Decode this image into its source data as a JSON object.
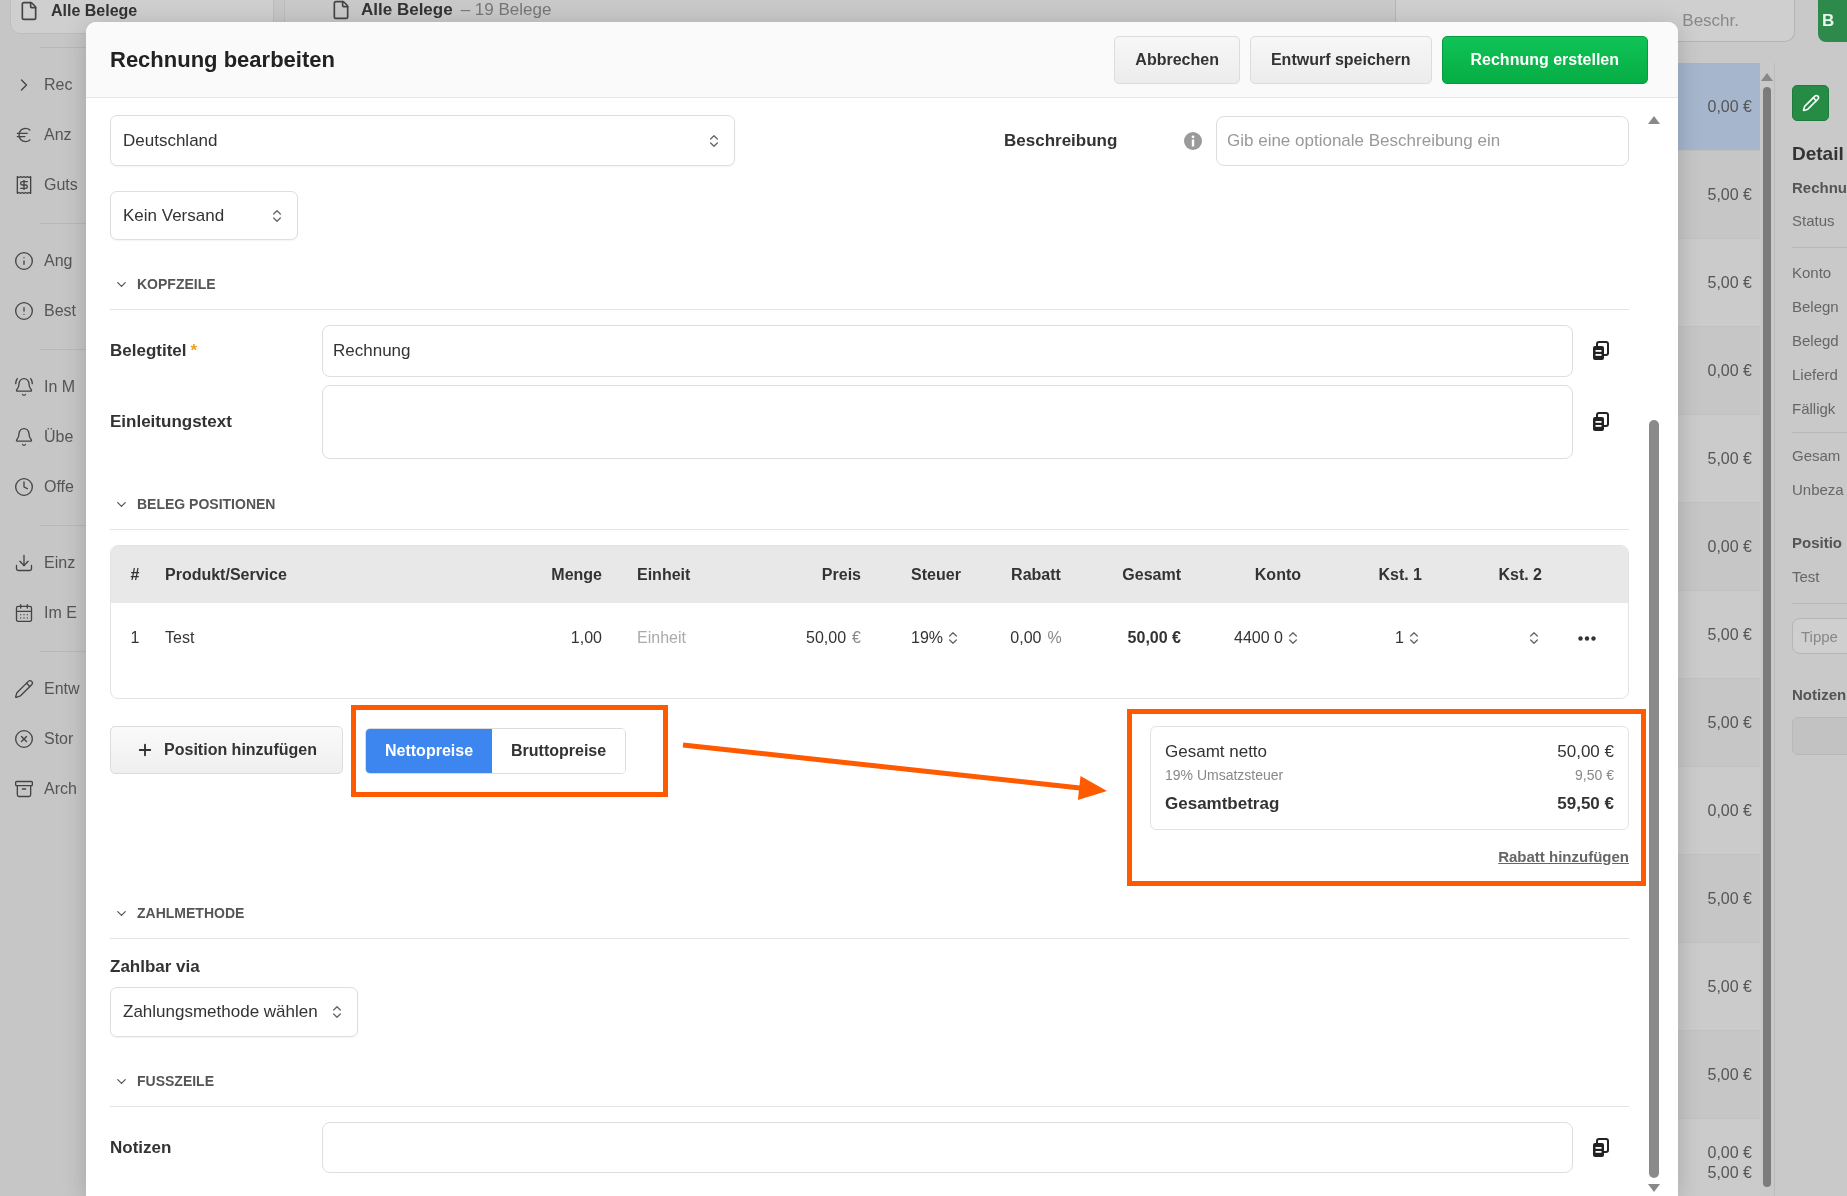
{
  "background": {
    "sidebar": {
      "top_item": "Alle Belege",
      "groups": [
        [
          {
            "label": "Rec"
          },
          {
            "label": "Anz"
          },
          {
            "label": "Guts"
          }
        ],
        [
          {
            "label": "Ang"
          },
          {
            "label": "Best"
          }
        ],
        [
          {
            "label": "In M"
          },
          {
            "label": "Übe"
          },
          {
            "label": "Offe"
          }
        ],
        [
          {
            "label": "Einz"
          },
          {
            "label": "Im E"
          }
        ],
        [
          {
            "label": "Entw"
          },
          {
            "label": "Stor"
          },
          {
            "label": "Arch"
          }
        ]
      ]
    },
    "list": {
      "title": "Alle Belege",
      "count": "– 19 Belege",
      "search_placeholder": "Beschr.",
      "new_button": "B",
      "rows": [
        {
          "values": [
            "0,00 €"
          ],
          "selected": true
        },
        {
          "values": [
            "5,00 €"
          ],
          "selected": false
        },
        {
          "values": [
            "5,00 €"
          ],
          "selected": false
        },
        {
          "values": [
            "0,00 €"
          ],
          "selected": false
        },
        {
          "values": [
            "5,00 €"
          ],
          "selected": false
        },
        {
          "values": [
            "0,00 €"
          ],
          "selected": false
        },
        {
          "values": [
            "5,00 €"
          ],
          "selected": false
        },
        {
          "values": [
            "5,00 €"
          ],
          "selected": false
        },
        {
          "values": [
            "0,00 €"
          ],
          "selected": false
        },
        {
          "values": [
            "5,00 €"
          ],
          "selected": false
        },
        {
          "values": [
            "5,00 €"
          ],
          "selected": false
        },
        {
          "values": [
            "5,00 €"
          ],
          "selected": false
        },
        {
          "values": [
            "0,00 €",
            "5,00 €"
          ],
          "selected": false
        }
      ]
    },
    "details": {
      "title": "Detail",
      "heading": "Rechnu",
      "status": "Status",
      "fields": [
        "Konto",
        "Belegn",
        "Belegd",
        "Lieferd",
        "Fälligk"
      ],
      "totals": [
        "Gesam",
        "Unbeza"
      ],
      "positions_heading": "Positio",
      "positions": [
        "Test"
      ],
      "comment_placeholder": "Tippe",
      "notes_heading": "Notizen"
    }
  },
  "dialog": {
    "title": "Rechnung bearbeiten",
    "buttons": [
      {
        "label": "Abbrechen",
        "kind": "secondary"
      },
      {
        "label": "Entwurf speichern",
        "kind": "secondary"
      },
      {
        "label": "Rechnung erstellen",
        "kind": "primary"
      }
    ],
    "country": "Deutschland",
    "shipping": "Kein Versand",
    "description": {
      "label": "Beschreibung",
      "placeholder": "Gib eine optionale Beschreibung ein"
    },
    "header_section": {
      "title": "KOPFZEILE",
      "expanded": true,
      "fields": [
        {
          "label": "Belegtitel",
          "required_mark": "*",
          "value": "Rechnung",
          "kind": "line"
        },
        {
          "label": "Einleitungstext",
          "kind": "area"
        }
      ]
    },
    "items_section": {
      "title": "BELEG POSITIONEN",
      "expanded": true,
      "columns": [
        "#",
        "Produkt/Service",
        "Menge",
        "Einheit",
        "Preis",
        "Steuer",
        "Rabatt",
        "Gesamt",
        "Konto",
        "Kst. 1",
        "Kst. 2"
      ],
      "rows": [
        {
          "number": "1",
          "product": "Test",
          "quantity": "1,00",
          "unit_placeholder": "Einheit",
          "price": "50,00",
          "price_currency": "€",
          "tax": "19%",
          "discount": "0,00",
          "discount_unit": "%",
          "total": "50,00 €",
          "account": "4400 0",
          "cost_center_1": "1"
        }
      ],
      "add_button": "Position hinzufügen",
      "price_modes": [
        {
          "label": "Nettopreise",
          "selected": true
        },
        {
          "label": "Bruttopreise",
          "selected": false
        }
      ],
      "summary": {
        "rows": [
          {
            "label": "Gesamt netto",
            "value": "50,00 €",
            "kind": "normal"
          },
          {
            "label": "19% Umsatzsteuer",
            "value": "9,50 €",
            "kind": "muted"
          },
          {
            "label": "Gesamtbetrag",
            "value": "59,50 €",
            "kind": "total"
          }
        ],
        "discount_link": "Rabatt hinzufügen"
      }
    },
    "payment_section": {
      "title": "ZAHLMETHODE",
      "expanded": true,
      "label": "Zahlbar via",
      "value": "Zahlungsmethode wählen"
    },
    "footer_section": {
      "title": "FUSSZEILE",
      "expanded": true,
      "label": "Notizen"
    }
  }
}
